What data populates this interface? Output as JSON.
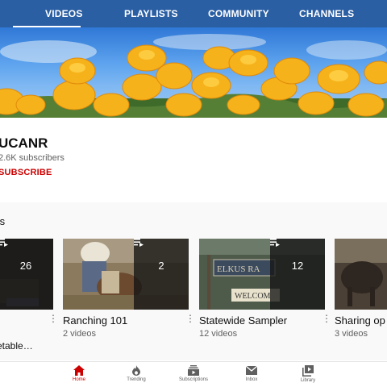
{
  "tabs": [
    {
      "label": "VIDEOS"
    },
    {
      "label": "PLAYLISTS"
    },
    {
      "label": "COMMUNITY"
    },
    {
      "label": "CHANNELS"
    }
  ],
  "channel": {
    "name": "UCANR",
    "subscribers": "2.6K subscribers",
    "subscribe_label": "SUBSCRIBE"
  },
  "section": {
    "title": "ts"
  },
  "playlists": [
    {
      "title": "",
      "meta": "",
      "count": "26",
      "cut_title": "etable…"
    },
    {
      "title": "Ranching 101",
      "meta": "2 videos",
      "count": "2"
    },
    {
      "title": "Statewide Sampler",
      "meta": "12 videos",
      "count": "12"
    },
    {
      "title": "Sharing op",
      "meta": "3 videos"
    }
  ],
  "bottom_nav": [
    {
      "label": "Home",
      "icon": "home-icon",
      "active": true
    },
    {
      "label": "Trending",
      "icon": "trending-icon"
    },
    {
      "label": "Subscriptions",
      "icon": "subscriptions-icon"
    },
    {
      "label": "Inbox",
      "icon": "inbox-icon"
    },
    {
      "label": "Library",
      "icon": "library-icon"
    }
  ],
  "colors": {
    "header": "#2b5fa3",
    "brand_red": "#cc0000",
    "text_secondary": "#606060"
  }
}
